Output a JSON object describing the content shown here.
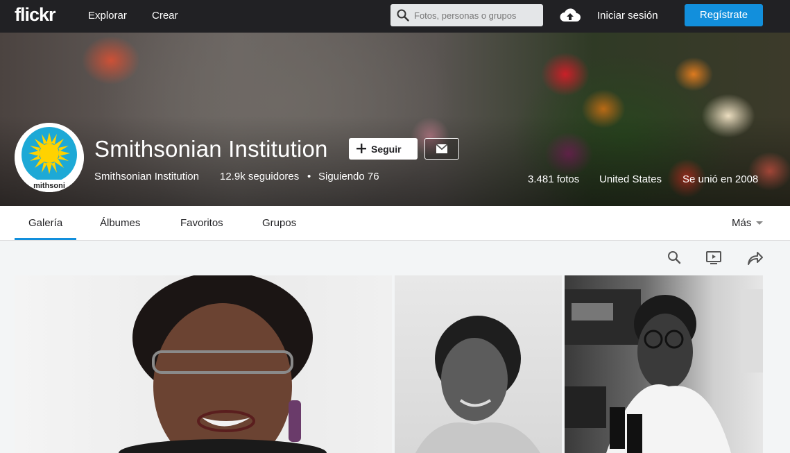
{
  "topbar": {
    "logo": "flickr",
    "nav": [
      "Explorar",
      "Crear"
    ],
    "search_placeholder": "Fotos, personas o grupos",
    "signin": "Iniciar sesión",
    "signup": "Regístrate"
  },
  "profile": {
    "name": "Smithsonian Institution",
    "follow_label": "Seguir",
    "real_name": "Smithsonian Institution",
    "followers": "12.9k seguidores",
    "separator": "•",
    "following": "Siguiendo 76",
    "photos": "3.481 fotos",
    "location": "United States",
    "joined": "Se unió en 2008",
    "avatar_text": "mithsoni"
  },
  "tabs": [
    "Galería",
    "Álbumes",
    "Favoritos",
    "Grupos"
  ],
  "more_label": "Más",
  "colors": {
    "accent": "#128fdc",
    "topbar": "#212124"
  },
  "icons": [
    "search-icon",
    "upload-cloud-icon",
    "plus-icon",
    "mail-icon",
    "slideshow-icon",
    "share-icon",
    "caret-down-icon"
  ]
}
